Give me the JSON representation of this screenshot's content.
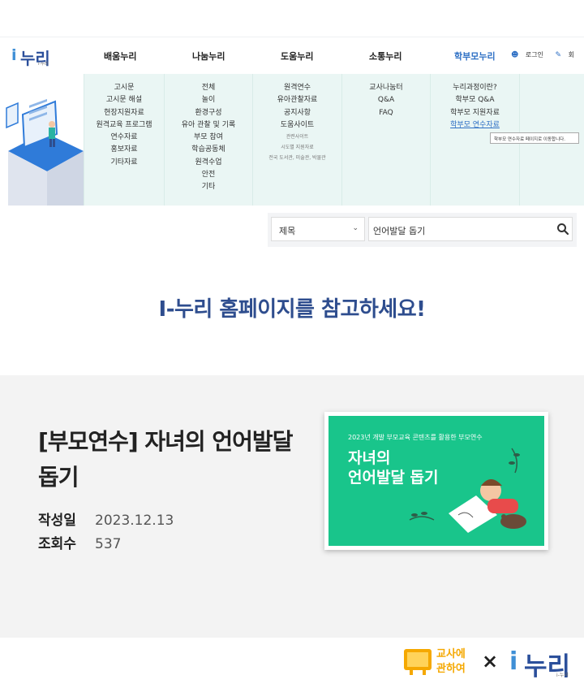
{
  "header": {
    "logo_sub": "i-누리",
    "menus": [
      "배움누리",
      "나눔누리",
      "도움누리",
      "소통누리",
      "학부모누리"
    ],
    "login": "로그인",
    "join": "회"
  },
  "mega": {
    "col1": [
      "고시문",
      "고시문 해설",
      "현장지원자료",
      "원격교육 프로그램",
      "연수자료",
      "홍보자료",
      "기타자료"
    ],
    "col2": [
      "전체",
      "놀이",
      "환경구성",
      "유아 관찰 및 기록",
      "부모 참여",
      "학습공동체",
      "원격수업",
      "안전",
      "기타"
    ],
    "col3": [
      "원격연수",
      "유아관찰자료",
      "공지사항",
      "도움사이트"
    ],
    "col3_small": [
      "관련사이트",
      "시도별 지원자료",
      "전국 도서관, 미술관, 박물관"
    ],
    "col4": [
      "교사나눔터",
      "Q&A",
      "FAQ"
    ],
    "col5": [
      "누리과정이란?",
      "학부모 Q&A",
      "학부모 지원자료",
      "학부모 연수자료"
    ],
    "tooltip": "학부모 연수자료 페이지로 이동합니다."
  },
  "search": {
    "select_value": "제목",
    "query": "언어발달 돕기"
  },
  "ref_title": "I-누리 홈페이지를 참고하세요!",
  "post": {
    "title_line1": "[부모연수] 자녀의 언어발달",
    "title_line2": "돕기",
    "date_label": "작성일",
    "date_value": "2023.12.13",
    "views_label": "조회수",
    "views_value": "537",
    "thumb_caption": "2023년 개발 부모교육 콘텐츠를 활용한 부모연수",
    "thumb_title1": "자녀의",
    "thumb_title2": "언어발달 돕기"
  },
  "footer": {
    "teacher_line1": "교사에",
    "teacher_line2": "관하여",
    "times": "×",
    "logo_sub": "i-누리"
  },
  "colors": {
    "accent": "#2d6fc4",
    "brand_navy": "#2e4d8e",
    "mega_bg": "#eaf6f4",
    "thumb_green": "#19c58b"
  }
}
